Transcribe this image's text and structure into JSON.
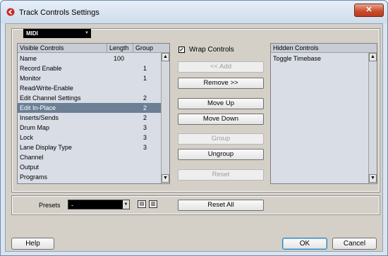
{
  "window": {
    "title": "Track Controls Settings",
    "close_glyph": "✕"
  },
  "midi_select": {
    "value": "MIDI",
    "arrow": "▼"
  },
  "visible_list": {
    "columns": [
      "Visible Controls",
      "Length",
      "Group"
    ],
    "rows": [
      {
        "name": "Name",
        "length": "100",
        "group": ""
      },
      {
        "name": "Record Enable",
        "length": "",
        "group": "1"
      },
      {
        "name": "Monitor",
        "length": "",
        "group": "1"
      },
      {
        "name": "Read/Write-Enable",
        "length": "",
        "group": ""
      },
      {
        "name": "Edit Channel Settings",
        "length": "",
        "group": "2"
      },
      {
        "name": "Edit In-Place",
        "length": "",
        "group": "2"
      },
      {
        "name": "Inserts/Sends",
        "length": "",
        "group": "2"
      },
      {
        "name": "Drum Map",
        "length": "",
        "group": "3"
      },
      {
        "name": "Lock",
        "length": "",
        "group": "3"
      },
      {
        "name": "Lane Display Type",
        "length": "",
        "group": "3"
      },
      {
        "name": "Channel",
        "length": "",
        "group": ""
      },
      {
        "name": "Output",
        "length": "",
        "group": ""
      },
      {
        "name": "Programs",
        "length": "",
        "group": ""
      }
    ],
    "selected_index": 5
  },
  "wrap_controls": {
    "label": "Wrap Controls",
    "checked": true,
    "check_glyph": "✓"
  },
  "buttons": {
    "add": "<< Add",
    "remove": "Remove >>",
    "move_up": "Move Up",
    "move_down": "Move Down",
    "group": "Group",
    "ungroup": "Ungroup",
    "reset": "Reset",
    "reset_all": "Reset All"
  },
  "hidden_list": {
    "header": "Hidden Controls",
    "rows": [
      "Toggle Timebase"
    ]
  },
  "scroll": {
    "up": "▲",
    "down": "▼"
  },
  "presets": {
    "label": "Presets",
    "value": "-",
    "arrow": "▼",
    "icon1": "▤",
    "icon2": "▥"
  },
  "footer": {
    "help": "Help",
    "ok": "OK",
    "cancel": "Cancel"
  }
}
